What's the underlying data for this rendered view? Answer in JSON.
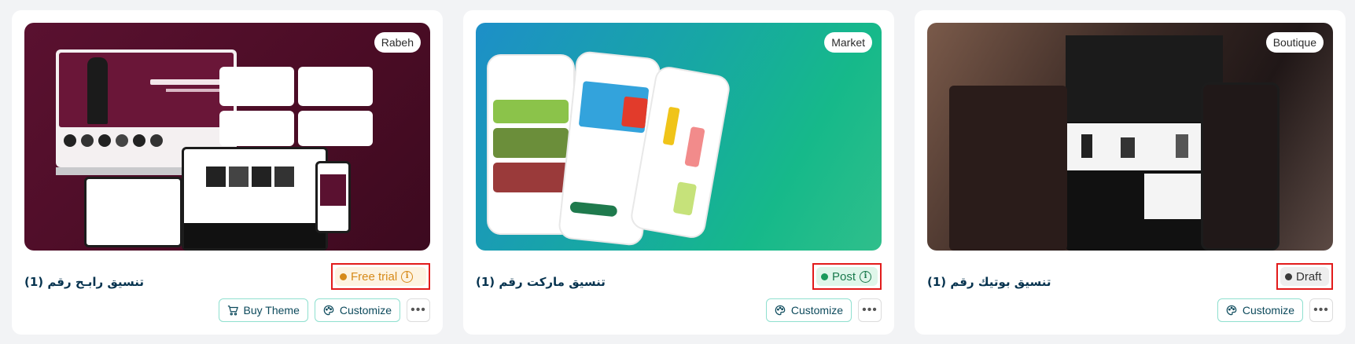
{
  "cards": [
    {
      "tag": "Rabeh",
      "title": "تنسيق رابـح رقم (1)",
      "status": "Free trial",
      "actions": {
        "buy": "Buy Theme",
        "customize": "Customize"
      }
    },
    {
      "tag": "Market",
      "title": "تنسيق ماركت رقم (1)",
      "status": "Post",
      "actions": {
        "customize": "Customize"
      }
    },
    {
      "tag": "Boutique",
      "title": "تنسيق بوتيك رقم (1)",
      "status": "Draft",
      "actions": {
        "customize": "Customize"
      }
    }
  ],
  "colors": {
    "trial": "#d68a1a",
    "post": "#1a9a5c",
    "draft": "#3a3a3a",
    "highlight": "#e21b1b"
  },
  "icons": {
    "info": "info-icon",
    "cart": "cart-icon",
    "palette": "palette-icon",
    "more": "more-icon"
  }
}
